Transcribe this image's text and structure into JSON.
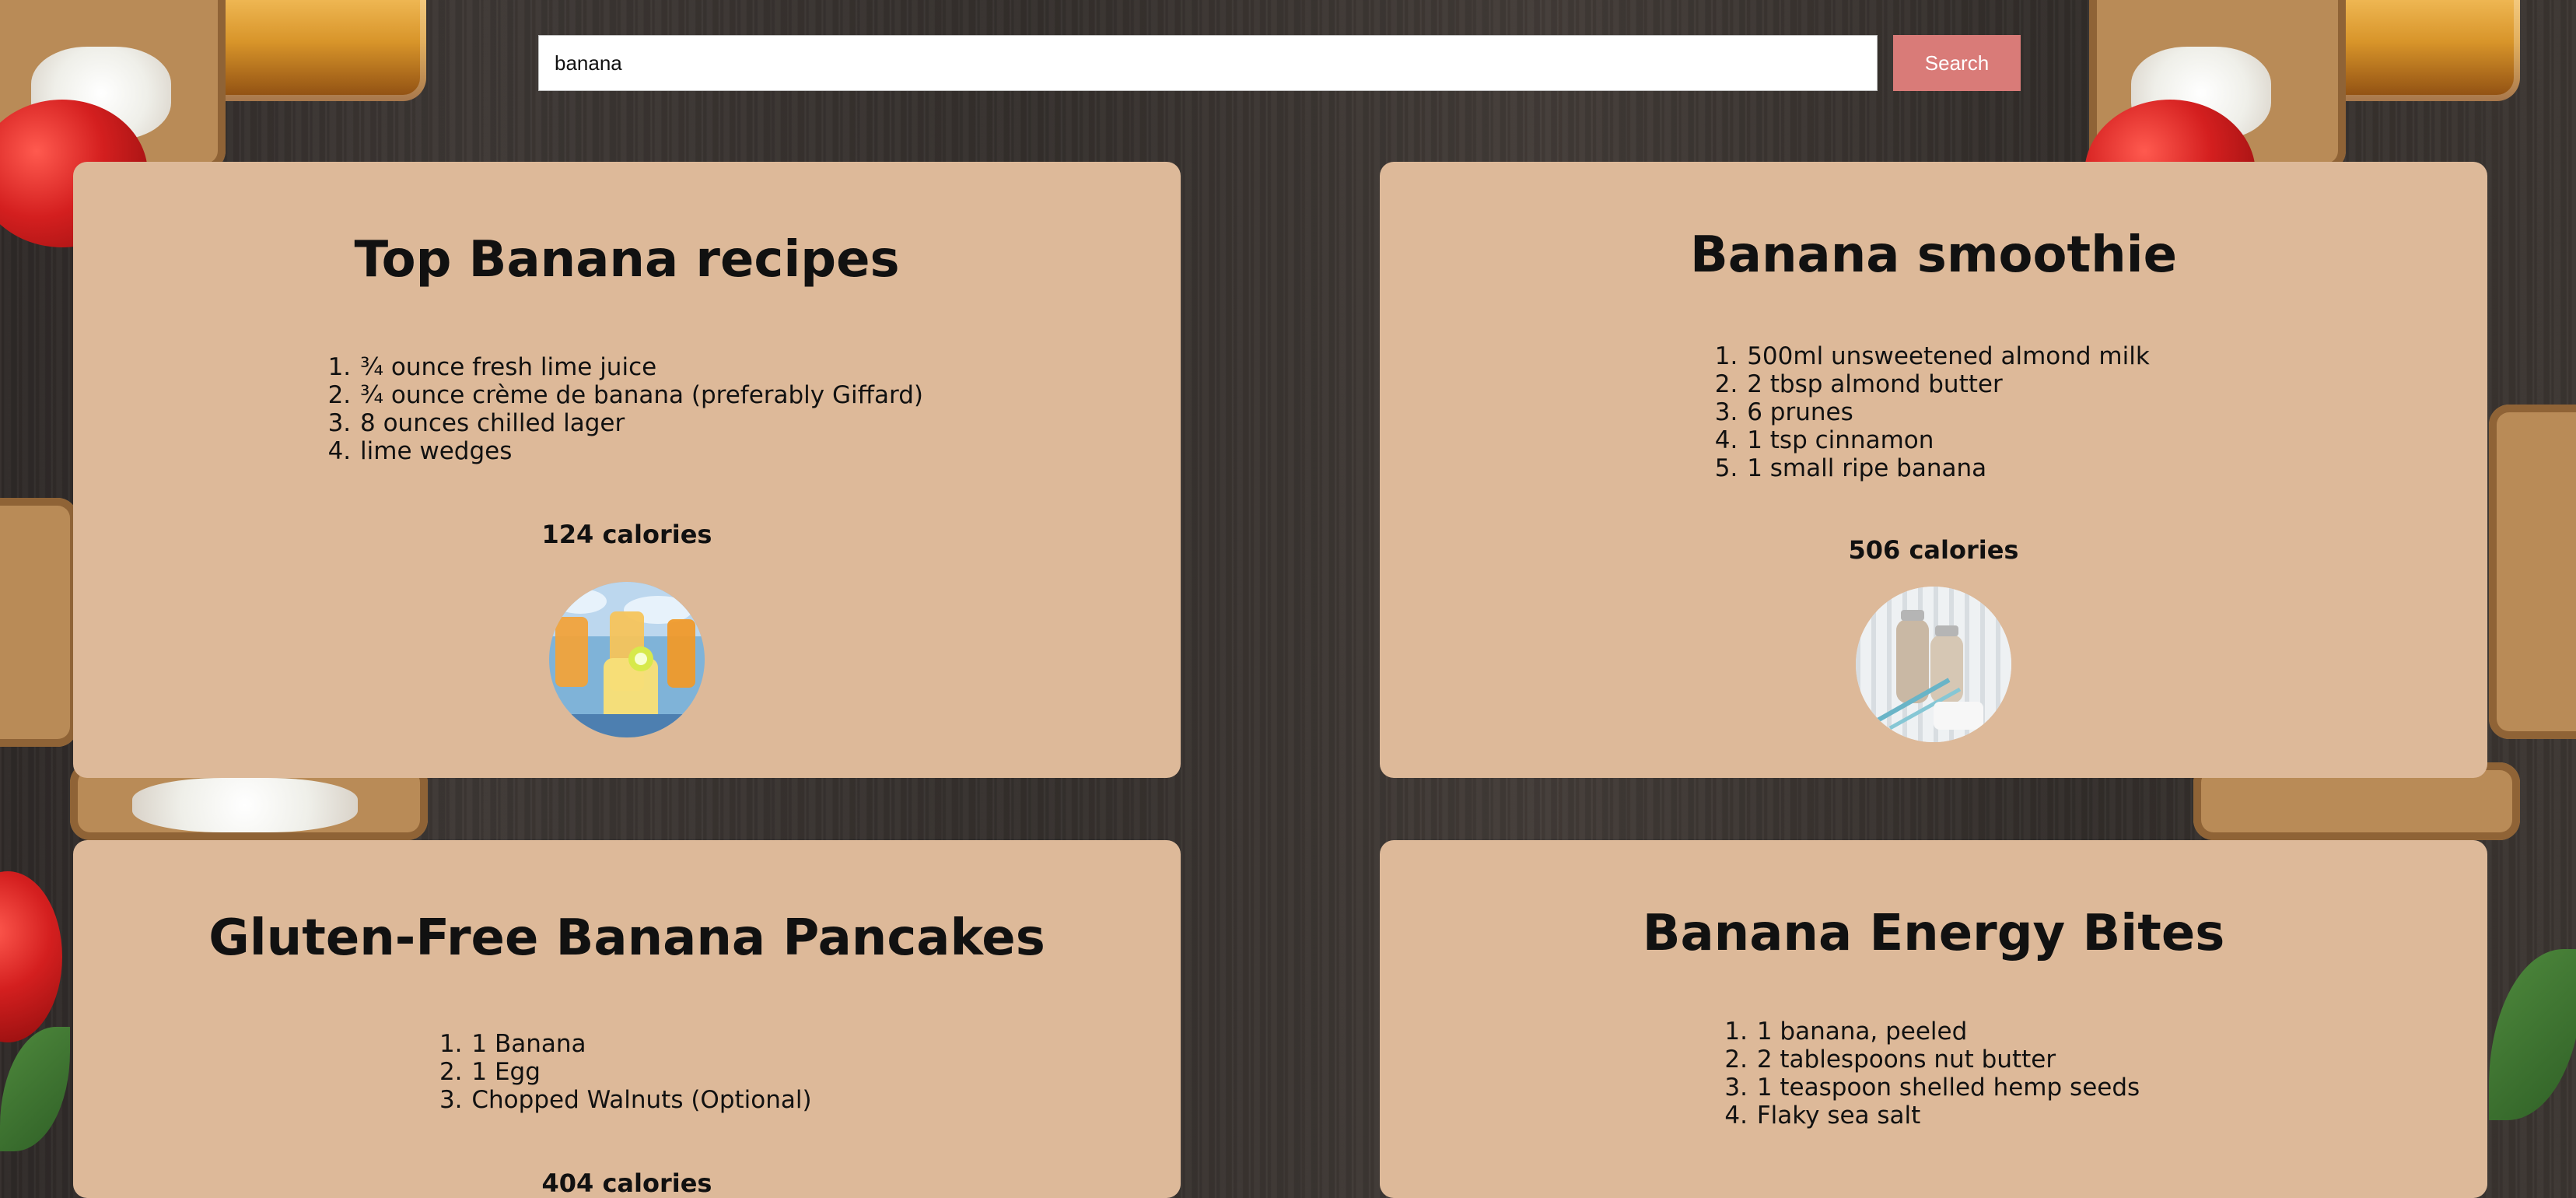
{
  "search": {
    "value": "banana",
    "button_label": "Search"
  },
  "recipes": [
    {
      "title": "Top Banana recipes",
      "ingredients": [
        "¾ ounce fresh lime juice",
        "¾ ounce crème de banana (preferably Giffard)",
        "8 ounces chilled lager",
        "lime wedges"
      ],
      "calories": "124 calories",
      "thumbnail": "cocktail-glasses-image"
    },
    {
      "title": "Banana smoothie",
      "ingredients": [
        "500ml unsweetened almond milk",
        "2 tbsp almond butter",
        "6 prunes",
        "1 tsp cinnamon",
        "1 small ripe banana"
      ],
      "calories": "506 calories",
      "thumbnail": "smoothie-bottles-image"
    },
    {
      "title": "Gluten-Free Banana Pancakes",
      "ingredients": [
        "1 Banana",
        "1 Egg",
        "Chopped Walnuts (Optional)"
      ],
      "calories": "404 calories"
    },
    {
      "title": "Banana Energy Bites",
      "ingredients": [
        "1 banana, peeled",
        "2 tablespoons nut butter",
        "1 teaspoon shelled hemp seeds",
        "Flaky sea salt"
      ],
      "calories": ""
    }
  ]
}
